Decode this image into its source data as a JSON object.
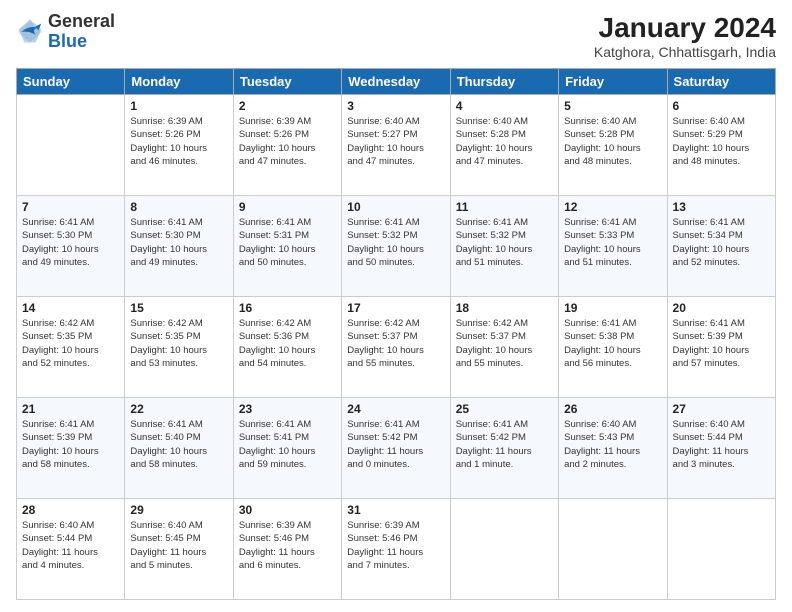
{
  "logo": {
    "general": "General",
    "blue": "Blue"
  },
  "header": {
    "title": "January 2024",
    "subtitle": "Katghora, Chhattisgarh, India"
  },
  "days_of_week": [
    "Sunday",
    "Monday",
    "Tuesday",
    "Wednesday",
    "Thursday",
    "Friday",
    "Saturday"
  ],
  "weeks": [
    [
      {
        "day": "",
        "info": ""
      },
      {
        "day": "1",
        "info": "Sunrise: 6:39 AM\nSunset: 5:26 PM\nDaylight: 10 hours\nand 46 minutes."
      },
      {
        "day": "2",
        "info": "Sunrise: 6:39 AM\nSunset: 5:26 PM\nDaylight: 10 hours\nand 47 minutes."
      },
      {
        "day": "3",
        "info": "Sunrise: 6:40 AM\nSunset: 5:27 PM\nDaylight: 10 hours\nand 47 minutes."
      },
      {
        "day": "4",
        "info": "Sunrise: 6:40 AM\nSunset: 5:28 PM\nDaylight: 10 hours\nand 47 minutes."
      },
      {
        "day": "5",
        "info": "Sunrise: 6:40 AM\nSunset: 5:28 PM\nDaylight: 10 hours\nand 48 minutes."
      },
      {
        "day": "6",
        "info": "Sunrise: 6:40 AM\nSunset: 5:29 PM\nDaylight: 10 hours\nand 48 minutes."
      }
    ],
    [
      {
        "day": "7",
        "info": "Sunrise: 6:41 AM\nSunset: 5:30 PM\nDaylight: 10 hours\nand 49 minutes."
      },
      {
        "day": "8",
        "info": "Sunrise: 6:41 AM\nSunset: 5:30 PM\nDaylight: 10 hours\nand 49 minutes."
      },
      {
        "day": "9",
        "info": "Sunrise: 6:41 AM\nSunset: 5:31 PM\nDaylight: 10 hours\nand 50 minutes."
      },
      {
        "day": "10",
        "info": "Sunrise: 6:41 AM\nSunset: 5:32 PM\nDaylight: 10 hours\nand 50 minutes."
      },
      {
        "day": "11",
        "info": "Sunrise: 6:41 AM\nSunset: 5:32 PM\nDaylight: 10 hours\nand 51 minutes."
      },
      {
        "day": "12",
        "info": "Sunrise: 6:41 AM\nSunset: 5:33 PM\nDaylight: 10 hours\nand 51 minutes."
      },
      {
        "day": "13",
        "info": "Sunrise: 6:41 AM\nSunset: 5:34 PM\nDaylight: 10 hours\nand 52 minutes."
      }
    ],
    [
      {
        "day": "14",
        "info": "Sunrise: 6:42 AM\nSunset: 5:35 PM\nDaylight: 10 hours\nand 52 minutes."
      },
      {
        "day": "15",
        "info": "Sunrise: 6:42 AM\nSunset: 5:35 PM\nDaylight: 10 hours\nand 53 minutes."
      },
      {
        "day": "16",
        "info": "Sunrise: 6:42 AM\nSunset: 5:36 PM\nDaylight: 10 hours\nand 54 minutes."
      },
      {
        "day": "17",
        "info": "Sunrise: 6:42 AM\nSunset: 5:37 PM\nDaylight: 10 hours\nand 55 minutes."
      },
      {
        "day": "18",
        "info": "Sunrise: 6:42 AM\nSunset: 5:37 PM\nDaylight: 10 hours\nand 55 minutes."
      },
      {
        "day": "19",
        "info": "Sunrise: 6:41 AM\nSunset: 5:38 PM\nDaylight: 10 hours\nand 56 minutes."
      },
      {
        "day": "20",
        "info": "Sunrise: 6:41 AM\nSunset: 5:39 PM\nDaylight: 10 hours\nand 57 minutes."
      }
    ],
    [
      {
        "day": "21",
        "info": "Sunrise: 6:41 AM\nSunset: 5:39 PM\nDaylight: 10 hours\nand 58 minutes."
      },
      {
        "day": "22",
        "info": "Sunrise: 6:41 AM\nSunset: 5:40 PM\nDaylight: 10 hours\nand 58 minutes."
      },
      {
        "day": "23",
        "info": "Sunrise: 6:41 AM\nSunset: 5:41 PM\nDaylight: 10 hours\nand 59 minutes."
      },
      {
        "day": "24",
        "info": "Sunrise: 6:41 AM\nSunset: 5:42 PM\nDaylight: 11 hours\nand 0 minutes."
      },
      {
        "day": "25",
        "info": "Sunrise: 6:41 AM\nSunset: 5:42 PM\nDaylight: 11 hours\nand 1 minute."
      },
      {
        "day": "26",
        "info": "Sunrise: 6:40 AM\nSunset: 5:43 PM\nDaylight: 11 hours\nand 2 minutes."
      },
      {
        "day": "27",
        "info": "Sunrise: 6:40 AM\nSunset: 5:44 PM\nDaylight: 11 hours\nand 3 minutes."
      }
    ],
    [
      {
        "day": "28",
        "info": "Sunrise: 6:40 AM\nSunset: 5:44 PM\nDaylight: 11 hours\nand 4 minutes."
      },
      {
        "day": "29",
        "info": "Sunrise: 6:40 AM\nSunset: 5:45 PM\nDaylight: 11 hours\nand 5 minutes."
      },
      {
        "day": "30",
        "info": "Sunrise: 6:39 AM\nSunset: 5:46 PM\nDaylight: 11 hours\nand 6 minutes."
      },
      {
        "day": "31",
        "info": "Sunrise: 6:39 AM\nSunset: 5:46 PM\nDaylight: 11 hours\nand 7 minutes."
      },
      {
        "day": "",
        "info": ""
      },
      {
        "day": "",
        "info": ""
      },
      {
        "day": "",
        "info": ""
      }
    ]
  ]
}
